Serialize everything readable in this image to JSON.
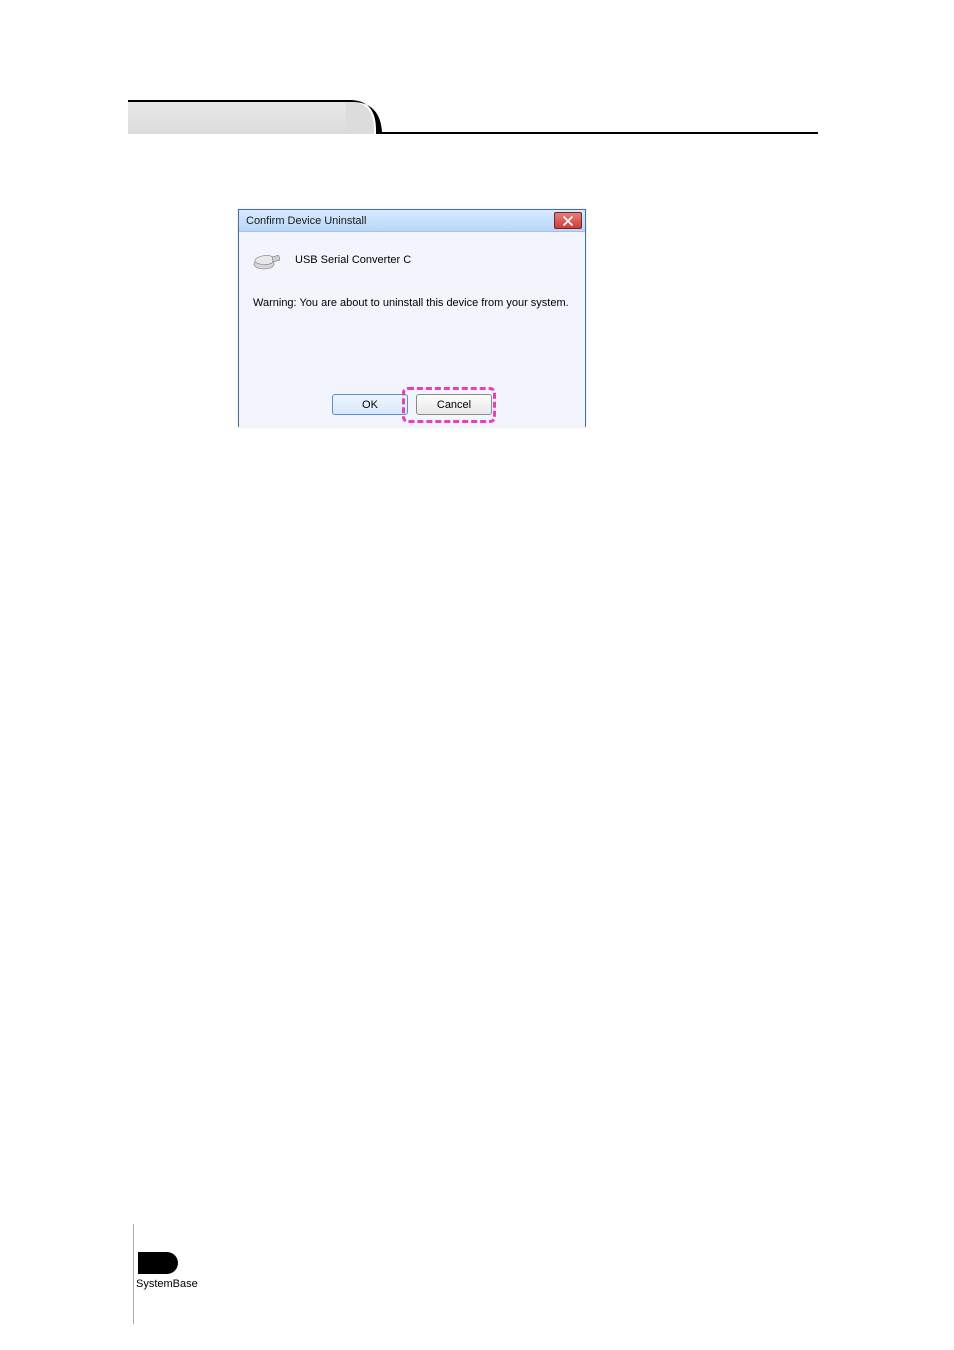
{
  "dialog": {
    "title": "Confirm Device Uninstall",
    "device_name": "USB Serial Converter C",
    "warning": "Warning: You are about to uninstall this device from your system.",
    "ok_label": "OK",
    "cancel_label": "Cancel"
  },
  "footer": {
    "brand": "SystemBase"
  }
}
